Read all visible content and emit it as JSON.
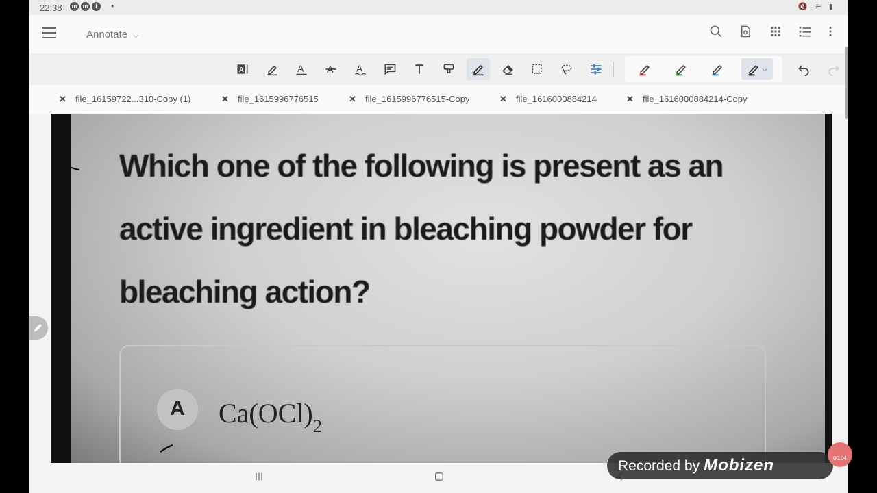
{
  "status": {
    "time": "22:38",
    "notif_icons": [
      "m",
      "m",
      "f"
    ],
    "dot": "•",
    "right_icons": "🔇 ≋ ▮"
  },
  "appbar": {
    "mode_label": "Annotate",
    "actions": [
      "search-icon",
      "page-thumbnail-icon",
      "grid-icon",
      "list-icon",
      "more-vert-icon"
    ]
  },
  "toolbar": {
    "tools": [
      "text-box-icon",
      "highlight-icon",
      "underline-icon",
      "strikethrough-icon",
      "squiggly-icon",
      "comment-icon",
      "text-icon",
      "stamp-icon",
      "pen-icon",
      "eraser-icon",
      "rect-select-icon",
      "lasso-icon",
      "adjust-icon"
    ],
    "active_tool": "pen-icon",
    "pen_colors": [
      "#e53935",
      "#43a047",
      "#1e88e5",
      "#444444"
    ],
    "undo": "undo-icon",
    "redo": "redo-icon"
  },
  "tabs": [
    {
      "label": "file_16159722...310-Copy (1)"
    },
    {
      "label": "file_1615996776515"
    },
    {
      "label": "file_1615996776515-Copy"
    },
    {
      "label": "file_1616000884214"
    },
    {
      "label": "file_1616000884214-Copy"
    }
  ],
  "document": {
    "question": "Which one of the following is present as an active ingredient in bleaching powder for bleaching action?",
    "option_letter": "A",
    "option_text": "Ca(OCl)",
    "option_sub": "2"
  },
  "overlay": {
    "recorded_by": "Recorded by",
    "brand": "Mobizen",
    "timer": "00:04"
  },
  "colors": {
    "accent": "#dfe3ea",
    "record": "#e57373"
  }
}
